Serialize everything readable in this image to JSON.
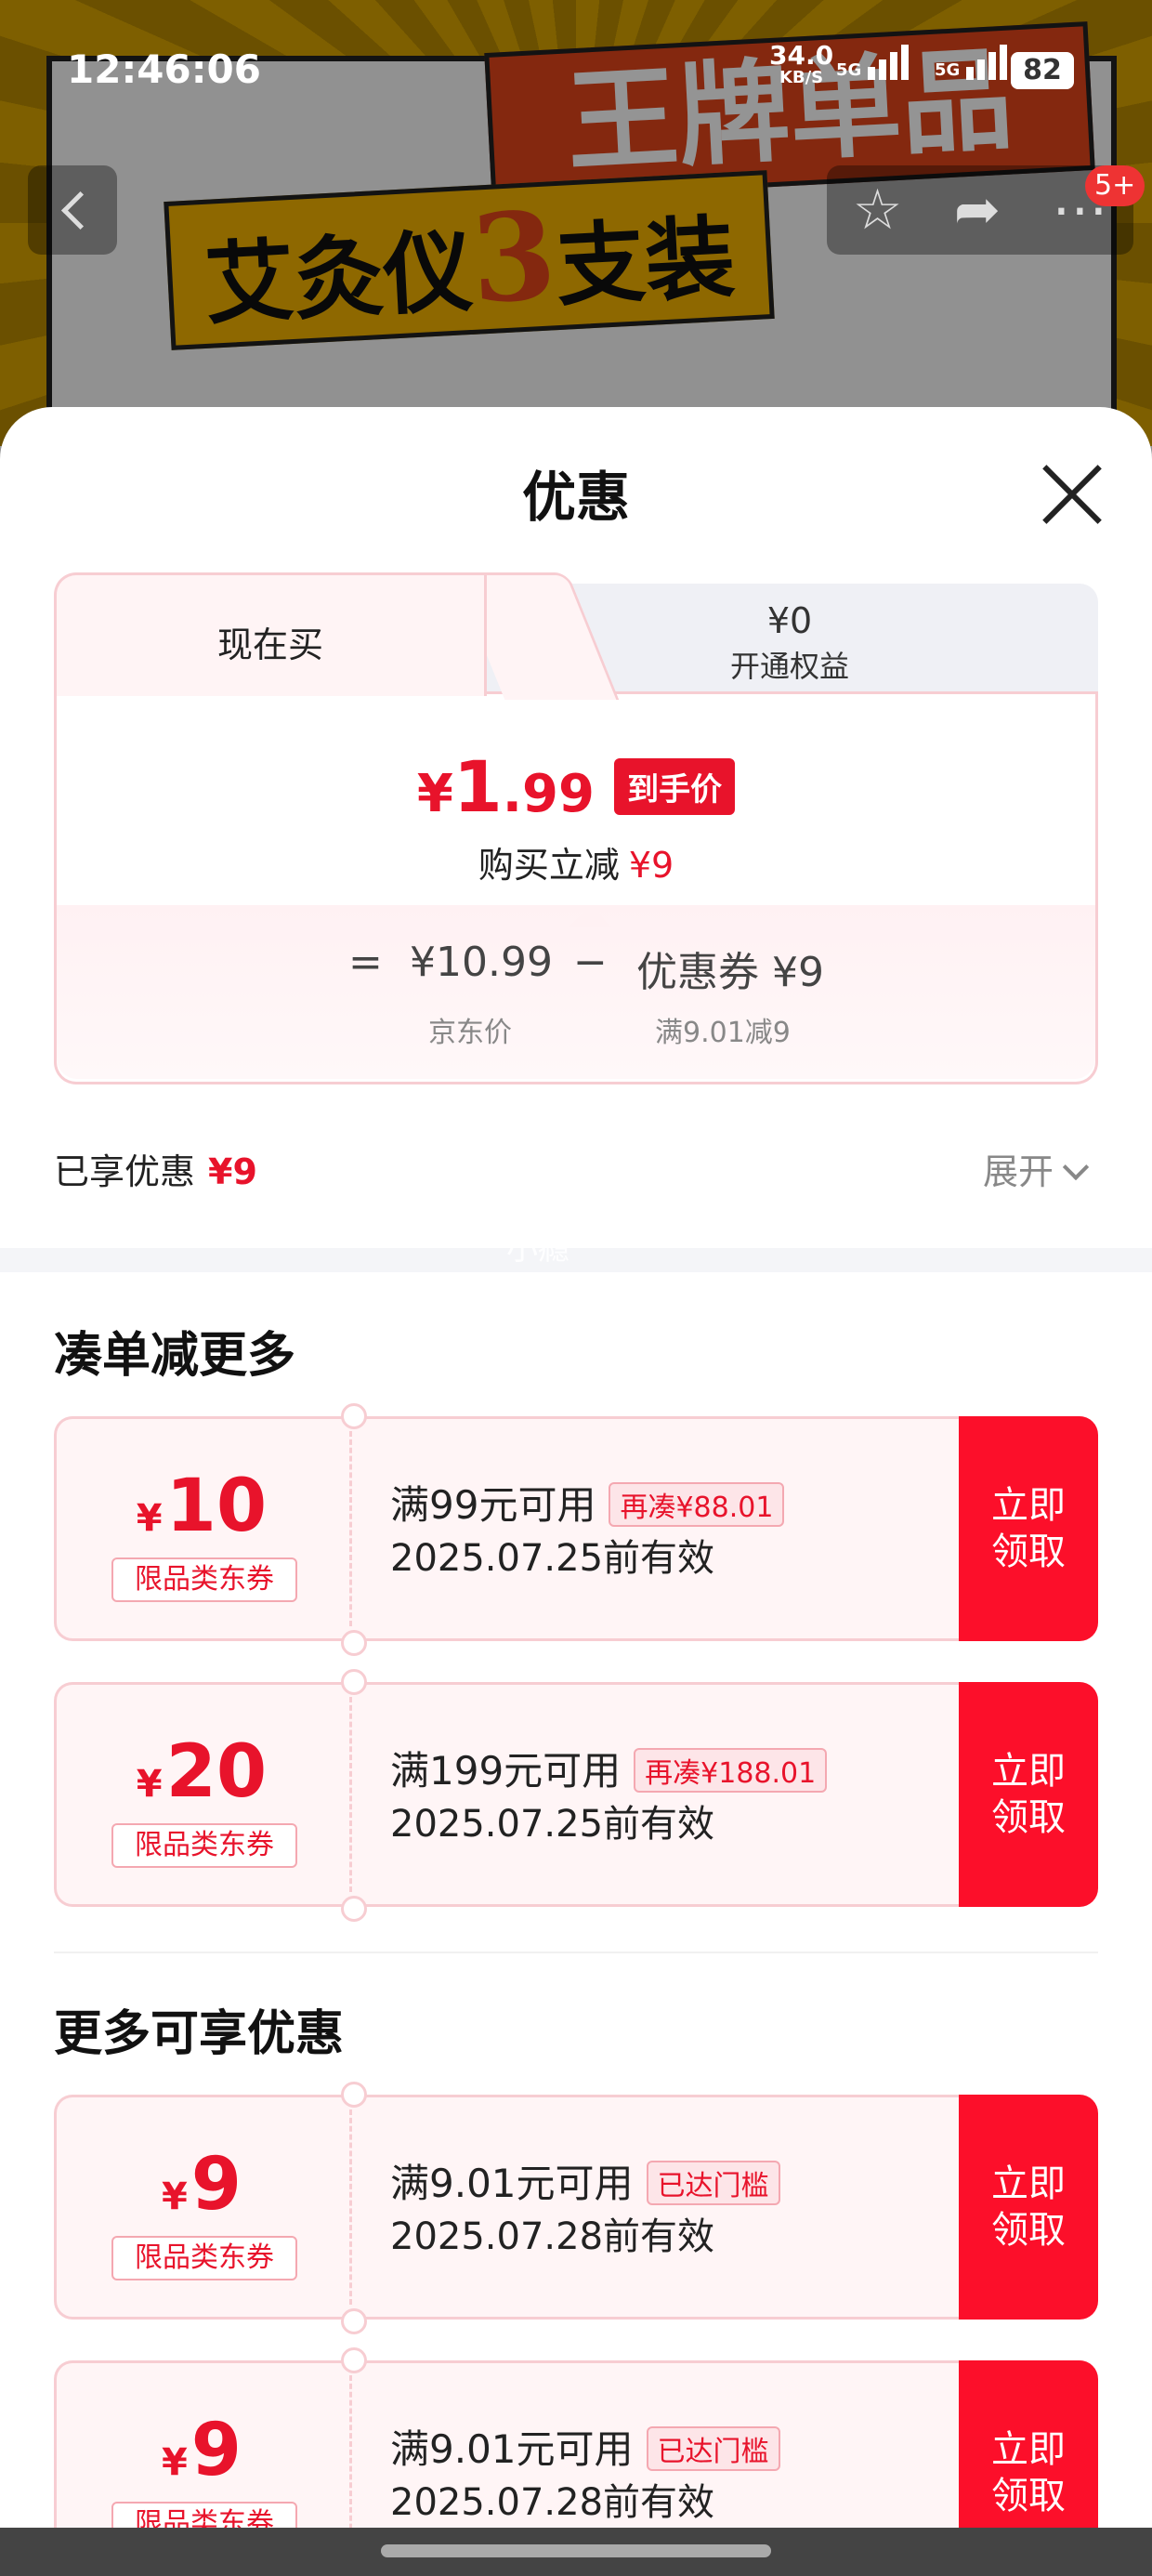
{
  "status_bar": {
    "time": "12:46:06",
    "net_speed": "34.0",
    "net_unit": "KB/S",
    "sig1": "5G",
    "sig2": "5G",
    "battery": "82"
  },
  "background": {
    "title1": "王牌单品",
    "title2_a": "艾灸仪",
    "title2_b": "3",
    "title2_c": "支装"
  },
  "nav": {
    "badge": "5+"
  },
  "sheet": {
    "title": "优惠",
    "tabs": {
      "now_label": "现在买",
      "member_amount": "¥0",
      "member_label": "开通权益"
    },
    "final": {
      "currency": "¥",
      "int": "1",
      "dec": ".99",
      "tag": "到手价"
    },
    "saved": {
      "label": "购买立减",
      "amount": "¥9"
    },
    "calc": {
      "eq": "=",
      "price": "¥10.99",
      "minus": "−",
      "coupon": "优惠券 ¥9",
      "price_label": "京东价",
      "coupon_label": "满9.01减9"
    },
    "enjoyed": {
      "label": "已享优惠",
      "amount": "¥9",
      "expand": "展开"
    },
    "watermark": "小瘾",
    "section1": "凑单减更多",
    "section2": "更多可享优惠"
  },
  "coupons": [
    {
      "currency": "¥",
      "amount": "10",
      "type": "限品类东券",
      "cond": "满99元可用",
      "tag": "再凑¥88.01",
      "valid": "2025.07.25前有效",
      "claim": "立即领取"
    },
    {
      "currency": "¥",
      "amount": "20",
      "type": "限品类东券",
      "cond": "满199元可用",
      "tag": "再凑¥188.01",
      "valid": "2025.07.25前有效",
      "claim": "立即领取"
    },
    {
      "currency": "¥",
      "amount": "9",
      "type": "限品类东券",
      "cond": "满9.01元可用",
      "tag": "已达门槛",
      "valid": "2025.07.28前有效",
      "claim": "立即领取"
    },
    {
      "currency": "¥",
      "amount": "9",
      "type": "限品类东券",
      "cond": "满9.01元可用",
      "tag": "已达门槛",
      "valid": "2025.07.28前有效",
      "claim": "立即领取"
    }
  ],
  "colors": {
    "accent": "#e8132b",
    "claim_bg": "#fc0f2a",
    "coupon_bg": "#fff5f6"
  }
}
